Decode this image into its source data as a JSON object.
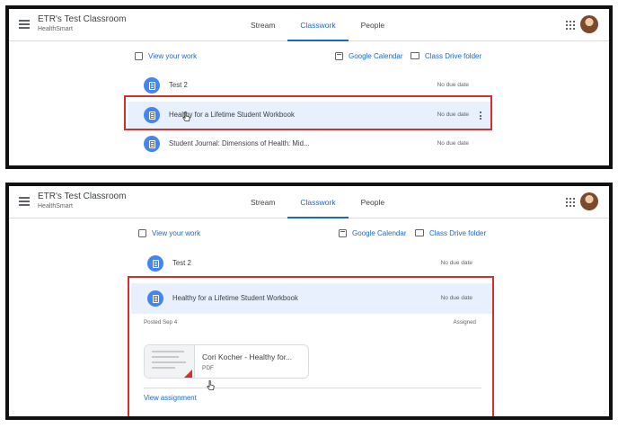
{
  "header": {
    "class_title": "ETR's Test Classroom",
    "class_subtitle": "HealthSmart",
    "tabs": [
      {
        "label": "Stream"
      },
      {
        "label": "Classwork"
      },
      {
        "label": "People"
      }
    ],
    "active_tab": "Classwork"
  },
  "links": {
    "view_work": "View your work",
    "calendar": "Google Calendar",
    "drive": "Class Drive folder"
  },
  "top_panel": {
    "items": [
      {
        "name": "Test 2",
        "due": "No due date"
      },
      {
        "name": "Healthy for a Lifetime Student Workbook",
        "due": "No due date"
      },
      {
        "name": "Student Journal: Dimensions of Health: Mid...",
        "due": "No due date"
      }
    ]
  },
  "bottom_panel": {
    "items": [
      {
        "name": "Test 2",
        "due": "No due date"
      },
      {
        "name": "Healthy for a Lifetime Student Workbook",
        "due": "No due date"
      }
    ],
    "posted": "Posted Sep 4",
    "status": "Assigned",
    "attachment": {
      "title": "Cori Kocher - Healthy for...",
      "type": "PDF"
    },
    "view_assignment": "View assignment"
  },
  "colors": {
    "accent": "#1967d2",
    "highlight_box": "#d32f2f",
    "assignment_icon": "#4285f4"
  }
}
